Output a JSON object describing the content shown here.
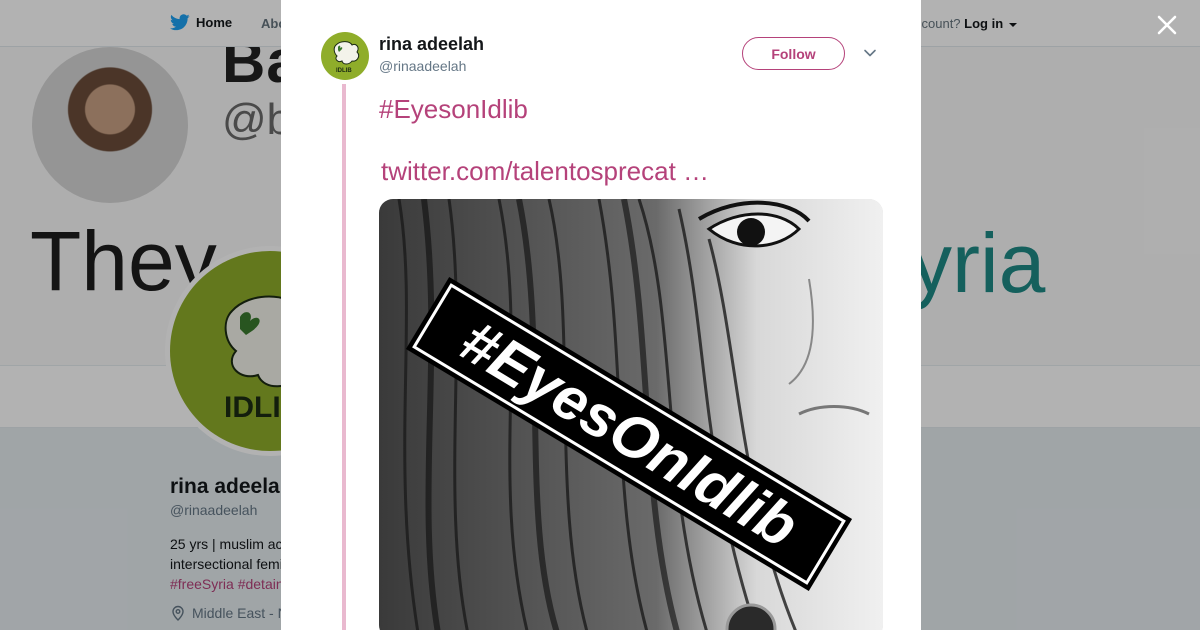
{
  "nav": {
    "home_label": "Home",
    "about_label": "Abo",
    "account_prompt": "ccount?",
    "login_label": "Log in"
  },
  "banner": {
    "name_fragment": "Ba",
    "handle_fragment": "@b",
    "left_text": "They",
    "right_text": "yria"
  },
  "profile": {
    "picture_text": "IDLI",
    "name": "rina adeela",
    "handle": "@rinaadeelah",
    "bio_line1": "25 yrs | muslim ac",
    "bio_line2": "intersectional femi",
    "bio_tags": "#freeSyria #detain",
    "location": "Middle East - N"
  },
  "tweet": {
    "author_name": "rina adeelah",
    "author_handle": "@rinaadeelah",
    "avatar_text": "IDLIB",
    "follow_label": "Follow",
    "hashtag": "#EyesonIdlib",
    "link": "twitter.com/talentosprecat …",
    "image_caption": "#EyesOnIdlib"
  },
  "colors": {
    "accent": "#b5427a",
    "thread_line": "#e9b9cf",
    "avatar_green": "#8fad2a",
    "twitter_blue": "#1da1f2"
  },
  "icons": {
    "close": "close-icon",
    "chevron": "chevron-down-icon",
    "location": "location-pin-icon",
    "logo": "twitter-bird-icon"
  }
}
